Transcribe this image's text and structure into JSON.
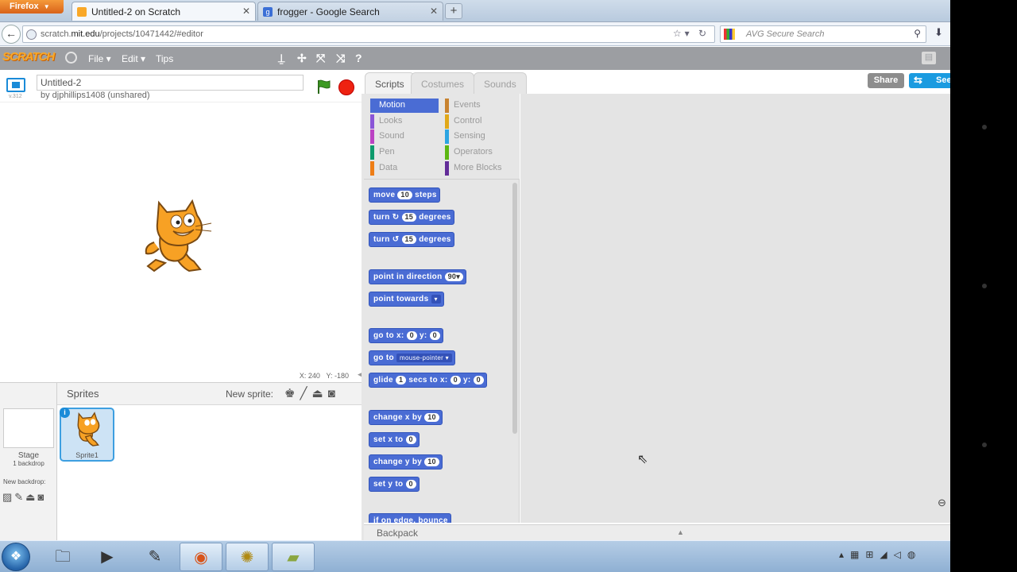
{
  "browser": {
    "firefox_button": "Firefox",
    "tabs": [
      {
        "title": "Untitled-2 on Scratch",
        "active": true
      },
      {
        "title": "frogger - Google Search",
        "active": false
      }
    ],
    "new_tab": "+",
    "url_host_prefix": "scratch.",
    "url_host_bold": "mit.edu",
    "url_path": "/projects/10471442/#editor",
    "search_placeholder": "AVG Secure Search"
  },
  "scratch": {
    "logo": "SCRATCH",
    "menus": [
      "File ▾",
      "Edit ▾",
      "Tips"
    ],
    "project": {
      "title": "Untitled-2",
      "byline": "by djphillips1408 (unshared)",
      "version": "v.312"
    },
    "coords": {
      "x_label": "X:",
      "x": "240",
      "y_label": "Y:",
      "y": "-180"
    },
    "sprites_panel": {
      "title": "Sprites",
      "new_sprite_label": "New sprite:",
      "stage_label": "Stage",
      "stage_sub": "1 backdrop",
      "new_backdrop_label": "New backdrop:",
      "sprite_name": "Sprite1"
    },
    "editor_tabs": [
      "Scripts",
      "Costumes",
      "Sounds"
    ],
    "share_button": "Share",
    "see_button": "See",
    "categories": {
      "left": [
        {
          "label": "Motion",
          "color": "#4a6cd4",
          "selected": true
        },
        {
          "label": "Looks",
          "color": "#8a55d7"
        },
        {
          "label": "Sound",
          "color": "#bb42c3"
        },
        {
          "label": "Pen",
          "color": "#0e9a6c"
        },
        {
          "label": "Data",
          "color": "#ee7d16"
        }
      ],
      "right": [
        {
          "label": "Events",
          "color": "#c88330"
        },
        {
          "label": "Control",
          "color": "#e1a91a"
        },
        {
          "label": "Sensing",
          "color": "#2ca5e2"
        },
        {
          "label": "Operators",
          "color": "#5cb712"
        },
        {
          "label": "More Blocks",
          "color": "#632d99"
        }
      ]
    },
    "blocks": {
      "move": {
        "pre": "move",
        "num": "10",
        "post": "steps"
      },
      "turn_right": {
        "pre": "turn ↻",
        "num": "15",
        "post": "degrees"
      },
      "turn_left": {
        "pre": "turn ↺",
        "num": "15",
        "post": "degrees"
      },
      "point_dir": {
        "pre": "point in direction",
        "dd": "90▾"
      },
      "point_towards": {
        "pre": "point towards",
        "dd": "▾"
      },
      "goto_xy": {
        "pre": "go to x:",
        "x": "0",
        "mid": "y:",
        "y": "0"
      },
      "goto": {
        "pre": "go to",
        "dd": "mouse-pointer ▾"
      },
      "glide": {
        "pre": "glide",
        "secs": "1",
        "mid1": "secs to x:",
        "x": "0",
        "mid2": "y:",
        "y": "0"
      },
      "change_x": {
        "pre": "change x by",
        "num": "10"
      },
      "set_x": {
        "pre": "set x to",
        "num": "0"
      },
      "change_y": {
        "pre": "change y by",
        "num": "10"
      },
      "set_y": {
        "pre": "set y to",
        "num": "0"
      },
      "bounce": {
        "pre": "if on edge, bounce"
      }
    },
    "backpack": "Backpack"
  }
}
